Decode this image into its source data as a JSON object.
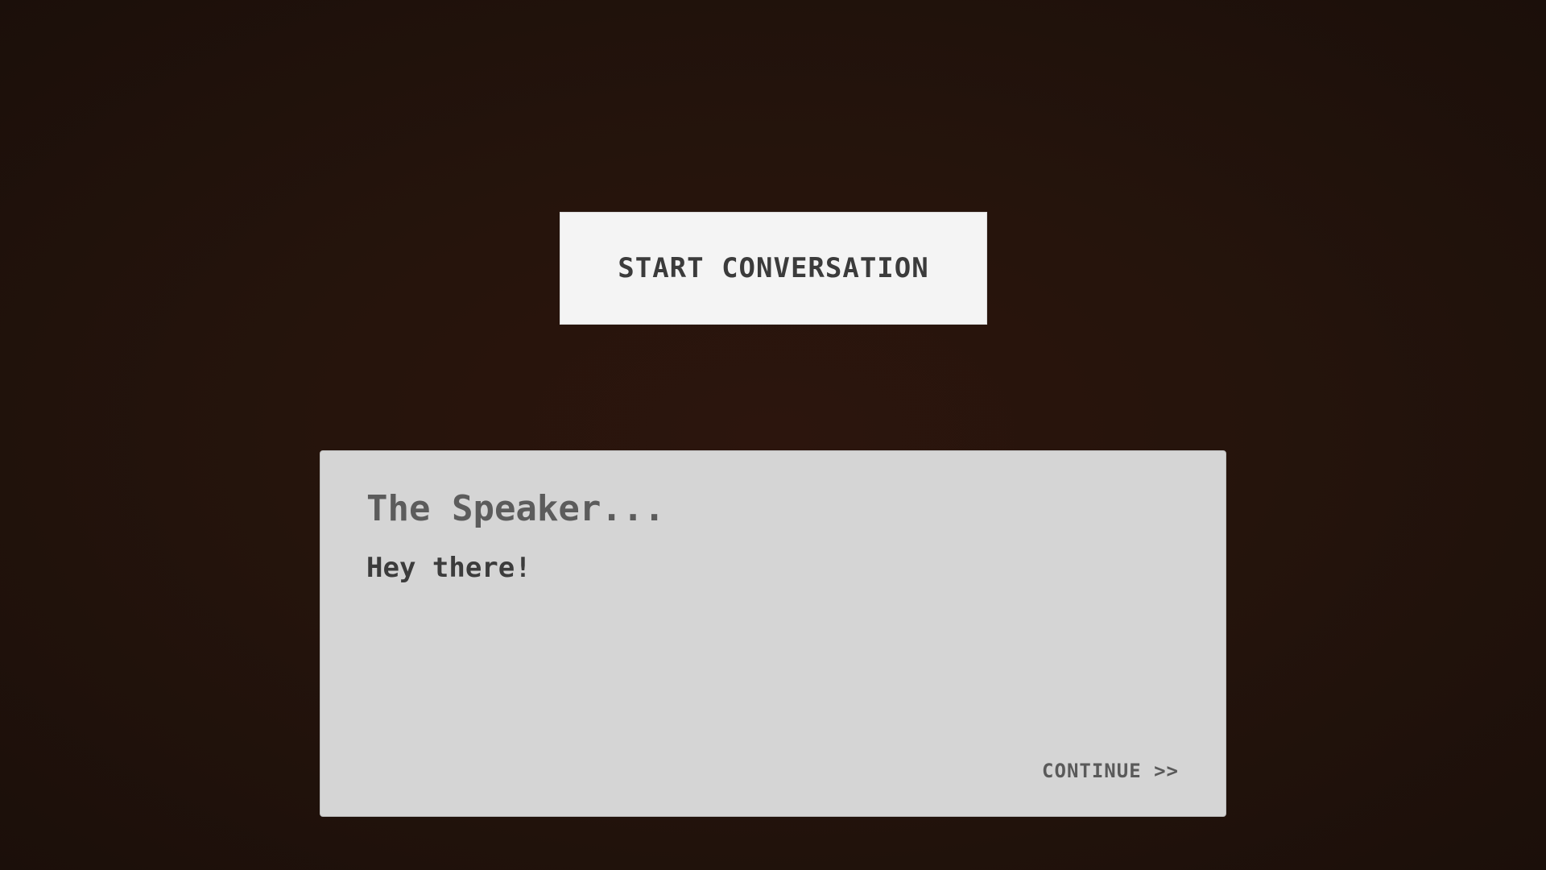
{
  "start_button": {
    "label": "START CONVERSATION"
  },
  "dialog": {
    "speaker_name": "The Speaker...",
    "text": "Hey there!",
    "continue_label": "CONTINUE >>"
  },
  "colors": {
    "background": "#25140c",
    "button_bg": "#f4f4f4",
    "dialog_bg": "#d5d5d5",
    "text_dark": "#3c3c3c"
  }
}
